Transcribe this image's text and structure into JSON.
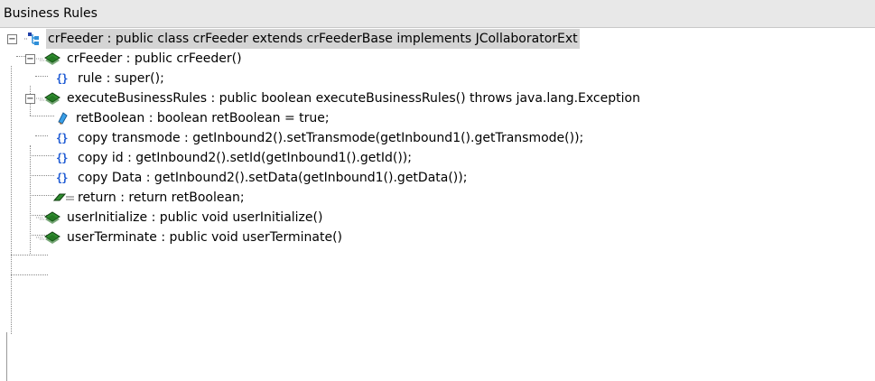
{
  "panel": {
    "title": "Business Rules"
  },
  "tree": {
    "root": {
      "label": "crFeeder : public class crFeeder extends crFeederBase implements JCollaboratorExt",
      "expanded": true,
      "icon": "class-icon"
    },
    "constructor": {
      "label": "crFeeder : public  crFeeder()",
      "expanded": true,
      "icon": "method-icon"
    },
    "constructor_rule": {
      "label": "rule : super();",
      "icon": "rule-braces-icon"
    },
    "method": {
      "label": "executeBusinessRules : public boolean executeBusinessRules() throws java.lang.Exception",
      "expanded": true,
      "icon": "method-icon"
    },
    "method_items": [
      {
        "label": "retBoolean : boolean retBoolean = true;",
        "icon": "variable-icon"
      },
      {
        "label": "copy transmode : getInbound2().setTransmode(getInbound1().getTransmode());",
        "icon": "rule-braces-icon"
      },
      {
        "label": "copy id : getInbound2().setId(getInbound1().getId());",
        "icon": "rule-braces-icon"
      },
      {
        "label": "copy Data : getInbound2().setData(getInbound1().getData());",
        "icon": "rule-braces-icon"
      },
      {
        "label": "return : return retBoolean;",
        "icon": "return-icon"
      }
    ],
    "userInitialize": {
      "label": "userInitialize : public void userInitialize()",
      "icon": "method-icon"
    },
    "userTerminate": {
      "label": "userTerminate : public void userTerminate()",
      "icon": "method-icon"
    }
  },
  "colors": {
    "selected_bg": "#d4d4d4",
    "method_green": "#2e8b2e",
    "rule_blue": "#1f5bd4"
  },
  "expander_symbols": {
    "expanded": "−"
  }
}
